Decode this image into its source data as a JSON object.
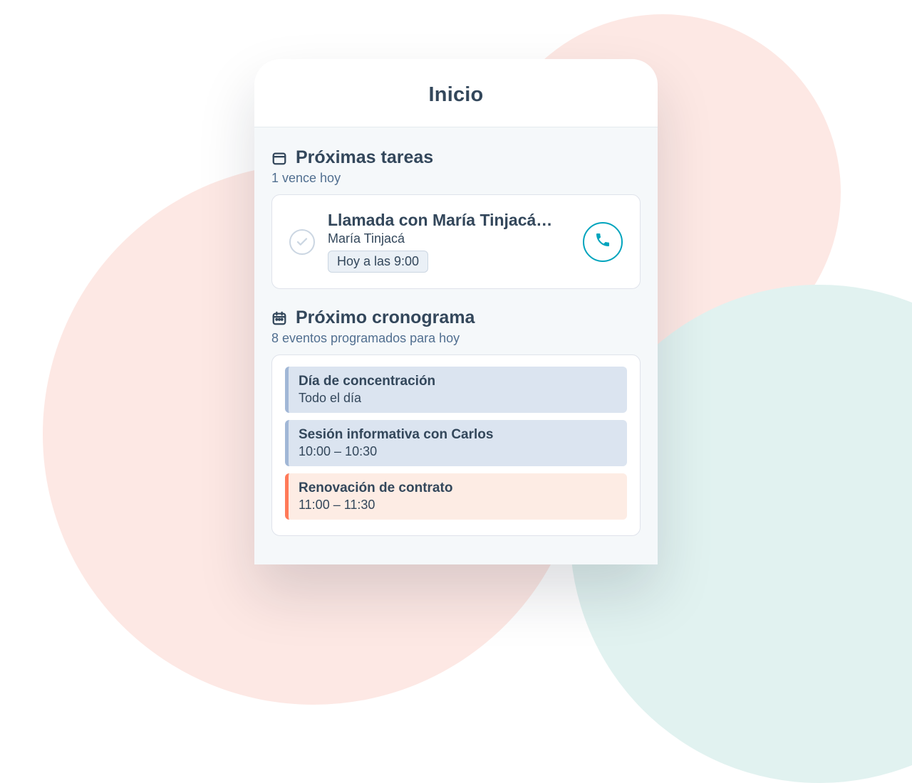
{
  "header": {
    "title": "Inicio"
  },
  "tasks": {
    "heading": "Próximas tareas",
    "subheading": "1 vence hoy",
    "items": [
      {
        "title": "Llamada con María Tinjacá…",
        "subtitle": "María Tinjacá",
        "time": "Hoy a las 9:00"
      }
    ]
  },
  "schedule": {
    "heading": "Próximo cronograma",
    "subheading": "8 eventos programados para hoy",
    "events": [
      {
        "title": "Día de concentración",
        "time": "Todo el día",
        "color": "blue"
      },
      {
        "title": "Sesión informativa con Carlos",
        "time": "10:00 – 10:30",
        "color": "blue"
      },
      {
        "title": "Renovación de contrato",
        "time": "11:00 – 11:30",
        "color": "orange"
      }
    ]
  }
}
